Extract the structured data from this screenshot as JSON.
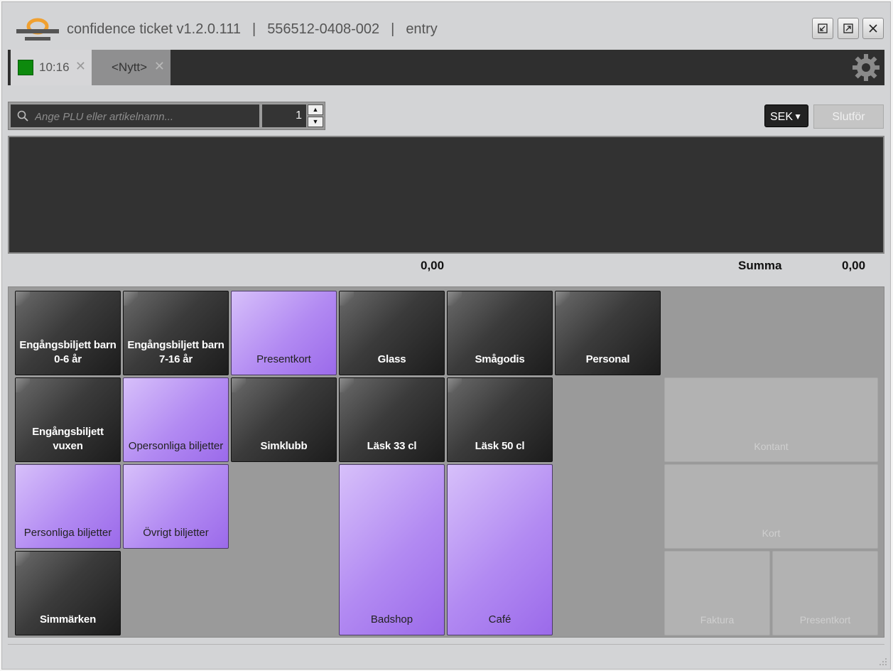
{
  "window": {
    "title_app": "confidence ticket v1.2.0.111",
    "title_separator": "|",
    "title_org": "556512-0408-002",
    "title_mode": "entry"
  },
  "tabs": [
    {
      "label": "10:16",
      "close": "✕",
      "status_color": "#0d8a0d",
      "active": true
    },
    {
      "label": "<Nytt>",
      "close": "✕",
      "active": false
    }
  ],
  "search": {
    "placeholder": "Ange PLU eller artikelnamn...",
    "value": ""
  },
  "quantity": {
    "value": "1",
    "up": "▲",
    "down": "▼"
  },
  "currency": {
    "selected": "SEK",
    "arrow": "▼"
  },
  "finish_label": "Slutför",
  "totals": {
    "subtotal": "0,00",
    "summa_label": "Summa",
    "summa_value": "0,00"
  },
  "colors": {
    "accent_purple": "#b28af2",
    "dark_button": "#2a2a2a",
    "status_green": "#0d8a0d",
    "logo_orange": "#f0a030"
  },
  "products": [
    {
      "label": "Engångsbiljett barn 0-6 år",
      "style": "dark"
    },
    {
      "label": "Engångsbiljett barn 7-16 år",
      "style": "dark"
    },
    {
      "label": "Presentkort",
      "style": "purple"
    },
    {
      "label": "Glass",
      "style": "dark"
    },
    {
      "label": "Smågodis",
      "style": "dark"
    },
    {
      "label": "Personal",
      "style": "dark"
    },
    {
      "label": "Engångsbiljett vuxen",
      "style": "dark"
    },
    {
      "label": "Opersonliga biljetter",
      "style": "purple"
    },
    {
      "label": "Simklubb",
      "style": "dark"
    },
    {
      "label": "Läsk 33 cl",
      "style": "dark"
    },
    {
      "label": "Läsk 50 cl",
      "style": "dark"
    },
    {
      "label": "Personliga biljetter",
      "style": "purple"
    },
    {
      "label": "Övrigt biljetter",
      "style": "purple"
    },
    {
      "label": "Badshop",
      "style": "purple"
    },
    {
      "label": "Café",
      "style": "purple"
    },
    {
      "label": "Simmärken",
      "style": "dark"
    }
  ],
  "payments": [
    {
      "label": "Kontant",
      "enabled": false
    },
    {
      "label": "Kort",
      "enabled": false
    },
    {
      "label": "Faktura",
      "enabled": false
    },
    {
      "label": "Presentkort",
      "enabled": false
    }
  ]
}
